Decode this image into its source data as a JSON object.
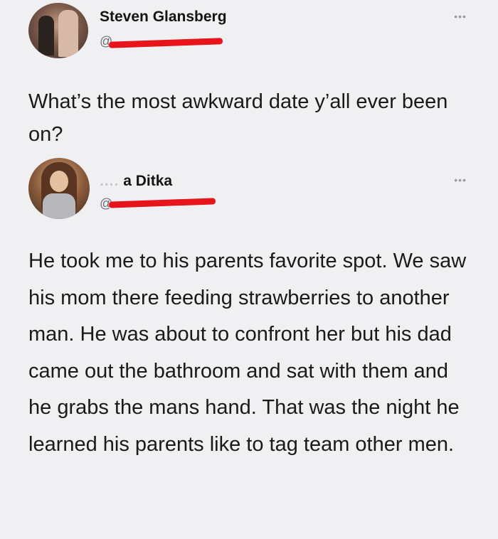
{
  "tweet_1": {
    "name": "Steven Glansberg",
    "handle_prefix": "@",
    "more_icon": "ellipsis-icon",
    "text": "What’s the most awkward date y’all ever been on?"
  },
  "tweet_2": {
    "name_obscured": "....",
    "name": "a Ditka",
    "handle_prefix": "@",
    "more_icon": "ellipsis-icon",
    "text": "He took me to his parents favorite spot. We saw his mom there feeding strawberries to another man. He was about to confront her but his dad came out the bathroom and sat with them and he grabs the mans hand. That was the night he learned his parents like to tag team other men."
  },
  "colors": {
    "background": "#f0f0f2",
    "redaction": "#e8141c",
    "handle": "#6f6f73"
  }
}
